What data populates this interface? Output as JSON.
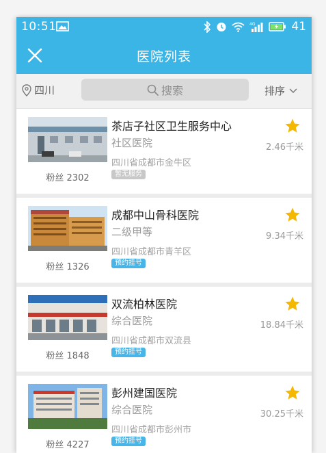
{
  "status_bar": {
    "time": "10:51",
    "battery": "41"
  },
  "nav": {
    "title": "医院列表"
  },
  "search": {
    "location": "四川",
    "placeholder": "搜索",
    "sort_label": "排序"
  },
  "colors": {
    "brand": "#3bb4e6",
    "star": "#f5b800",
    "badge": "#48b5e8"
  },
  "hospitals": [
    {
      "name": "茶店子社区卫生服务中心",
      "level": "社区医院",
      "address": "四川省成都市金牛区",
      "distance": "2.46千米",
      "fans": "粉丝 2302",
      "badge": "暂无服务",
      "badge_active": false
    },
    {
      "name": "成都中山骨科医院",
      "level": "二级甲等",
      "address": "四川省成都市青羊区",
      "distance": "9.34千米",
      "fans": "粉丝 1326",
      "badge": "预约挂号",
      "badge_active": true
    },
    {
      "name": "双流柏林医院",
      "level": "综合医院",
      "address": "四川省成都市双流县",
      "distance": "18.84千米",
      "fans": "粉丝 1848",
      "badge": "预约挂号",
      "badge_active": true
    },
    {
      "name": "彭州建国医院",
      "level": "综合医院",
      "address": "四川省成都市彭州市",
      "distance": "30.25千米",
      "fans": "粉丝 4227",
      "badge": "预约挂号",
      "badge_active": true
    }
  ]
}
